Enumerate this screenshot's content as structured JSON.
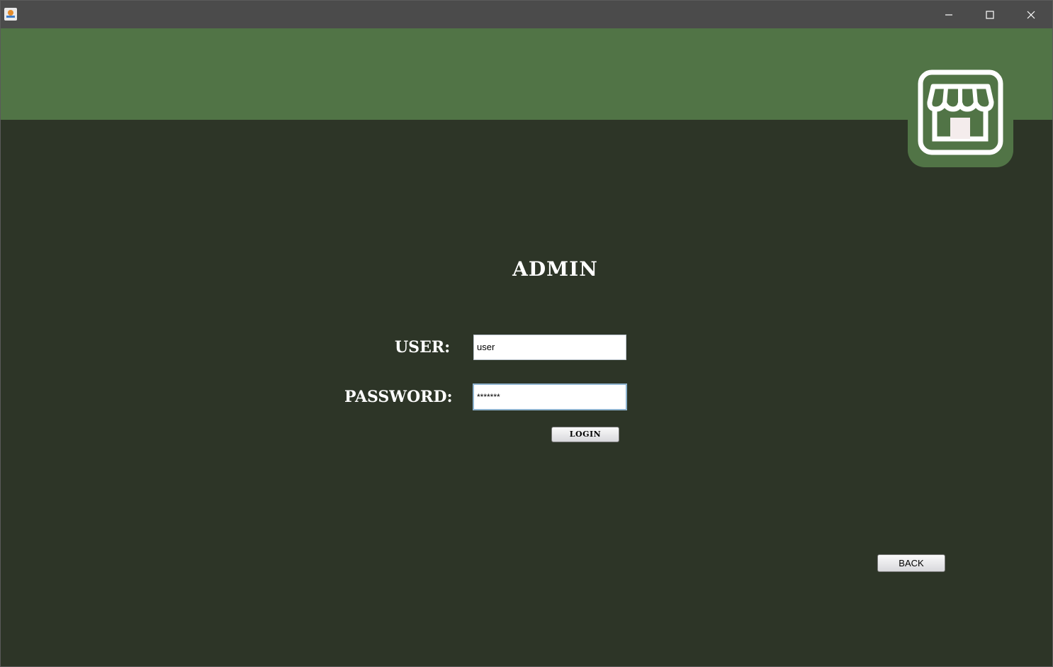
{
  "window": {
    "icon": "java-coffee-icon",
    "controls": [
      "minimize-icon",
      "maximize-icon",
      "close-icon"
    ]
  },
  "header": {
    "logo_icon": "storefront-icon",
    "accent_color": "#517446",
    "background_color": "#2d3527"
  },
  "login": {
    "title": "ADMIN",
    "user_label": "USER:",
    "user_value": "user",
    "password_label": "PASSWORD:",
    "password_value": "*******",
    "login_button": "LOGIN"
  },
  "footer": {
    "back_button": "BACK"
  }
}
